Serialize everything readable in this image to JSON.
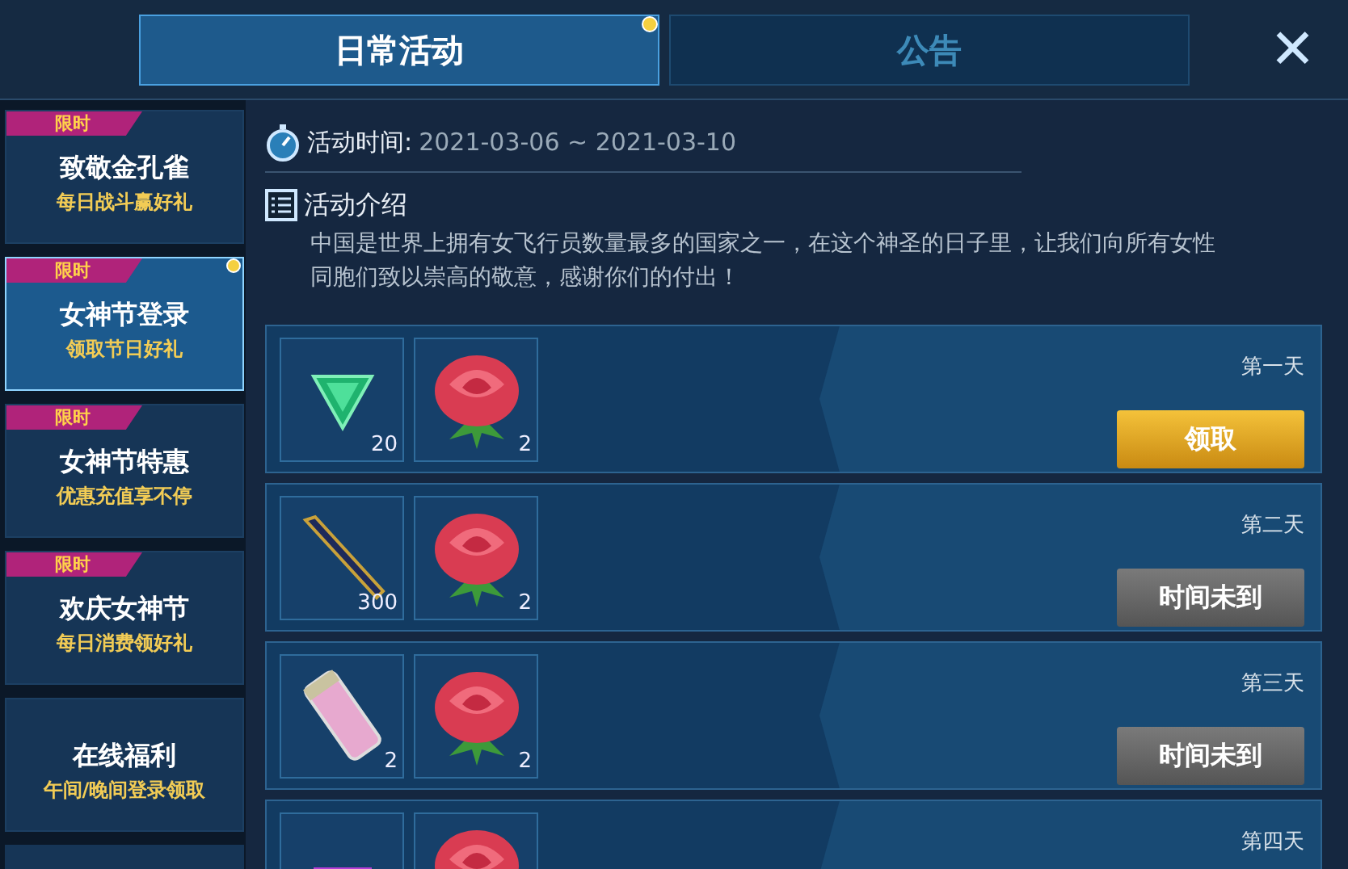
{
  "tabs": [
    {
      "label": "日常活动",
      "selected": true,
      "dot": true
    },
    {
      "label": "公告",
      "selected": false,
      "dot": false
    }
  ],
  "close": {
    "label": "✕"
  },
  "sidebar": {
    "items": [
      {
        "badge": "限时",
        "title": "致敬金孔雀",
        "subtitle": "每日战斗赢好礼",
        "selected": false,
        "dot": false
      },
      {
        "badge": "限时",
        "title": "女神节登录",
        "subtitle": "领取节日好礼",
        "selected": true,
        "dot": true
      },
      {
        "badge": "限时",
        "title": "女神节特惠",
        "subtitle": "优惠充值享不停",
        "selected": false,
        "dot": false
      },
      {
        "badge": "限时",
        "title": "欢庆女神节",
        "subtitle": "每日消费领好礼",
        "selected": false,
        "dot": false
      },
      {
        "title": "在线福利",
        "subtitle": "午间/晚间登录领取",
        "selected": false,
        "dot": false
      }
    ]
  },
  "activity": {
    "time_label": "活动时间:",
    "time_value": "2021-03-06 ~ 2021-03-10",
    "intro_title": "活动介绍",
    "intro_text": "中国是世界上拥有女飞行员数量最多的国家之一，在这个神圣的日子里，让我们向所有女性同胞们致以崇高的敬意，感谢你们的付出！"
  },
  "rewards": [
    {
      "day": "第一天",
      "button": {
        "label": "领取",
        "kind": "claim"
      },
      "items": [
        {
          "kind": "gem",
          "count": "20"
        },
        {
          "kind": "rose",
          "count": "2"
        }
      ]
    },
    {
      "day": "第二天",
      "button": {
        "label": "时间未到",
        "kind": "locked"
      },
      "items": [
        {
          "kind": "pen",
          "count": "300"
        },
        {
          "kind": "rose",
          "count": "2"
        }
      ]
    },
    {
      "day": "第三天",
      "button": {
        "label": "时间未到",
        "kind": "locked"
      },
      "items": [
        {
          "kind": "canister",
          "count": "2"
        },
        {
          "kind": "rose",
          "count": "2"
        }
      ]
    },
    {
      "day": "第四天",
      "items": [
        {
          "kind": "box"
        },
        {
          "kind": "rose"
        }
      ]
    }
  ]
}
